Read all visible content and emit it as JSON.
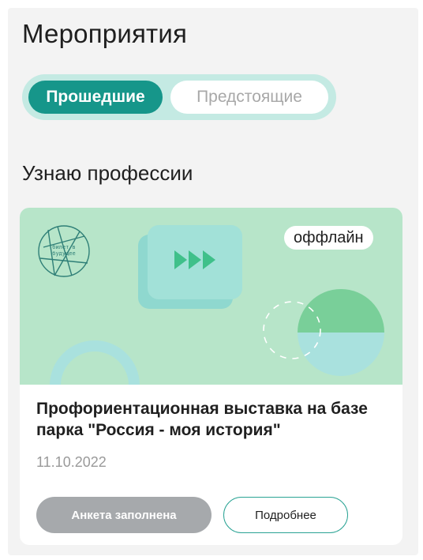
{
  "header": {
    "title": "Мероприятия"
  },
  "tabs": [
    {
      "label": "Прошедшие",
      "active": true
    },
    {
      "label": "Предстоящие",
      "active": false
    }
  ],
  "section": {
    "title": "Узнаю профессии"
  },
  "event_card": {
    "format_badge": "оффлайн",
    "title": "Профориентационная выставка на базе парка \"Россия - моя история\"",
    "date": "11.10.2022",
    "status_button": "Анкета заполнена",
    "details_button": "Подробнее",
    "logo_text": "билет в будущее"
  },
  "colors": {
    "accent": "#16968a",
    "tabs_background": "#c4eae3",
    "banner_background": "#b7e5c9",
    "disabled_button": "#a6a9ac"
  },
  "icons": [
    "fast-forward-icon",
    "logo-icon"
  ]
}
